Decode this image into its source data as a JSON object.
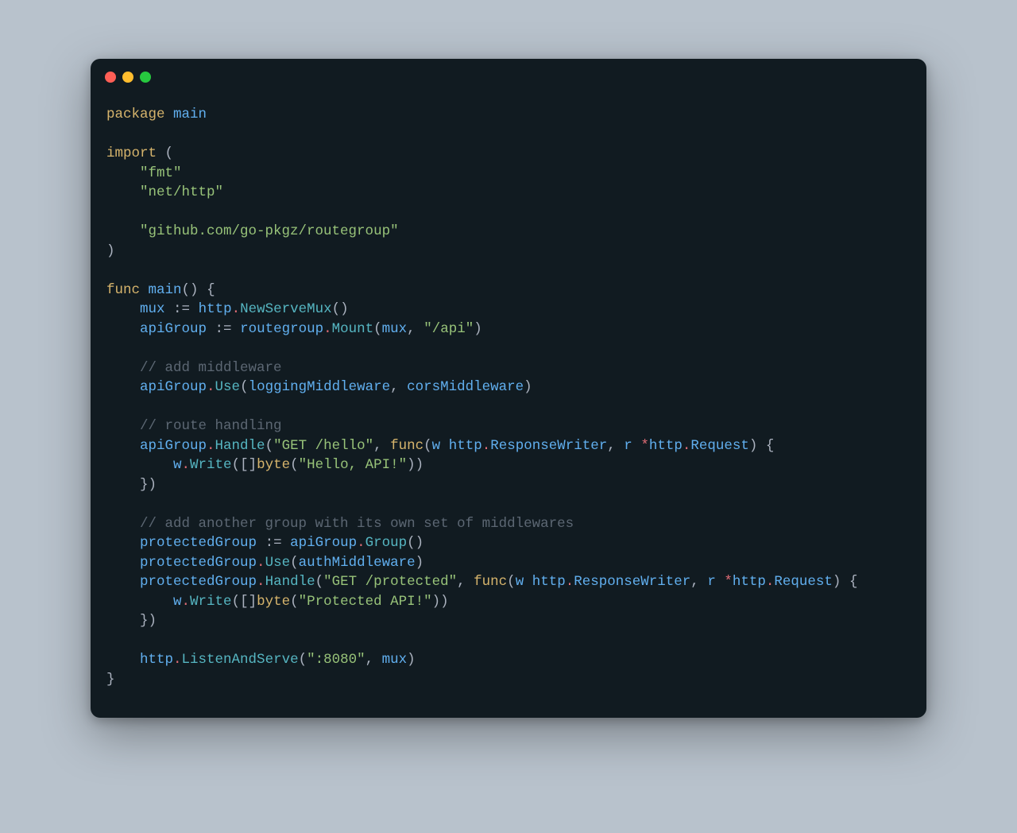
{
  "traffic_lights": {
    "close": "close",
    "minimize": "minimize",
    "maximize": "maximize"
  },
  "code": {
    "l1": {
      "package": "package",
      "main": "main"
    },
    "l3": {
      "import": "import",
      "open": "("
    },
    "l4": {
      "fmt": "\"fmt\""
    },
    "l5": {
      "nethttp": "\"net/http\""
    },
    "l7": {
      "routegroup": "\"github.com/go-pkgz/routegroup\""
    },
    "l8": {
      "close": ")"
    },
    "l10": {
      "func": "func",
      "main": "main",
      "parens": "()",
      "brace": "{"
    },
    "l11": {
      "mux": "mux",
      "asg": ":=",
      "http": "http",
      "dot": ".",
      "newservemux": "NewServeMux",
      "call": "()"
    },
    "l12": {
      "apigroup": "apiGroup",
      "asg": ":=",
      "routegroup": "routegroup",
      "dot": ".",
      "mount": "Mount",
      "open": "(",
      "mux": "mux",
      "comma": ",",
      "api": "\"/api\"",
      "close": ")"
    },
    "l14": {
      "cmt": "// add middleware"
    },
    "l15": {
      "apigroup": "apiGroup",
      "dot": ".",
      "use": "Use",
      "open": "(",
      "logging": "loggingMiddleware",
      "comma": ",",
      "cors": "corsMiddleware",
      "close": ")"
    },
    "l17": {
      "cmt": "// route handling"
    },
    "l18": {
      "apigroup": "apiGroup",
      "dot": ".",
      "handle": "Handle",
      "open": "(",
      "route": "\"GET /hello\"",
      "comma": ",",
      "func": "func",
      "open2": "(",
      "w": "w",
      "http1": "http",
      "dot2": ".",
      "rw": "ResponseWriter",
      "comma2": ",",
      "r": "r",
      "star": "*",
      "http2": "http",
      "dot3": ".",
      "req": "Request",
      "close2": ")",
      "brace": "{"
    },
    "l19": {
      "w": "w",
      "dot": ".",
      "write": "Write",
      "open": "(",
      "brackets": "[]",
      "byte": "byte",
      "open2": "(",
      "hello": "\"Hello, API!\"",
      "close2": ")",
      "close": ")"
    },
    "l20": {
      "closebrace": "}",
      "closeparen": ")"
    },
    "l22": {
      "cmt": "// add another group with its own set of middlewares"
    },
    "l23": {
      "pg": "protectedGroup",
      "asg": ":=",
      "apigroup": "apiGroup",
      "dot": ".",
      "group": "Group",
      "call": "()"
    },
    "l24": {
      "pg": "protectedGroup",
      "dot": ".",
      "use": "Use",
      "open": "(",
      "auth": "authMiddleware",
      "close": ")"
    },
    "l25": {
      "pg": "protectedGroup",
      "dot": ".",
      "handle": "Handle",
      "open": "(",
      "route": "\"GET /protected\"",
      "comma": ",",
      "func": "func",
      "open2": "(",
      "w": "w",
      "http1": "http",
      "dot2": ".",
      "rw": "ResponseWriter",
      "comma2": ",",
      "r": "r",
      "star": "*",
      "http2": "http",
      "dot3": ".",
      "req": "Request",
      "close2": ")",
      "brace": "{"
    },
    "l26": {
      "w": "w",
      "dot": ".",
      "write": "Write",
      "open": "(",
      "brackets": "[]",
      "byte": "byte",
      "open2": "(",
      "msg": "\"Protected API!\"",
      "close2": ")",
      "close": ")"
    },
    "l27": {
      "closebrace": "}",
      "closeparen": ")"
    },
    "l29": {
      "http": "http",
      "dot": ".",
      "listen": "ListenAndServe",
      "open": "(",
      "port": "\":8080\"",
      "comma": ",",
      "mux": "mux",
      "close": ")"
    },
    "l30": {
      "brace": "}"
    }
  }
}
